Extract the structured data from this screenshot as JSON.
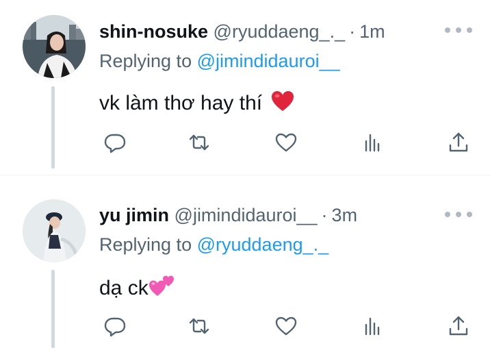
{
  "tweets": [
    {
      "display_name": "shin-nosuke",
      "handle": "@ryuddaeng_._",
      "separator": "·",
      "time": "1m",
      "replying_prefix": "Replying to",
      "replying_to": "@jimindidauroi__",
      "text": "vk làm thơ hay thí",
      "emoji": "heart-emoji"
    },
    {
      "display_name": "yu jimin",
      "handle": "@jimindidauroi__",
      "separator": "·",
      "time": "3m",
      "replying_prefix": "Replying to",
      "replying_to": "@ryuddaeng_._",
      "text": "dạ ck",
      "emoji": "two-hearts-emoji"
    }
  ],
  "actions": [
    "reply-icon",
    "retweet-icon",
    "like-icon",
    "analytics-icon",
    "share-icon"
  ],
  "colors": {
    "mention": "#1d9bf0",
    "secondary_text": "#536471",
    "primary_text": "#0f1419",
    "thread_line": "#cfd9de",
    "heart": "#e0243b",
    "pink_hearts": "#f05ab4"
  }
}
